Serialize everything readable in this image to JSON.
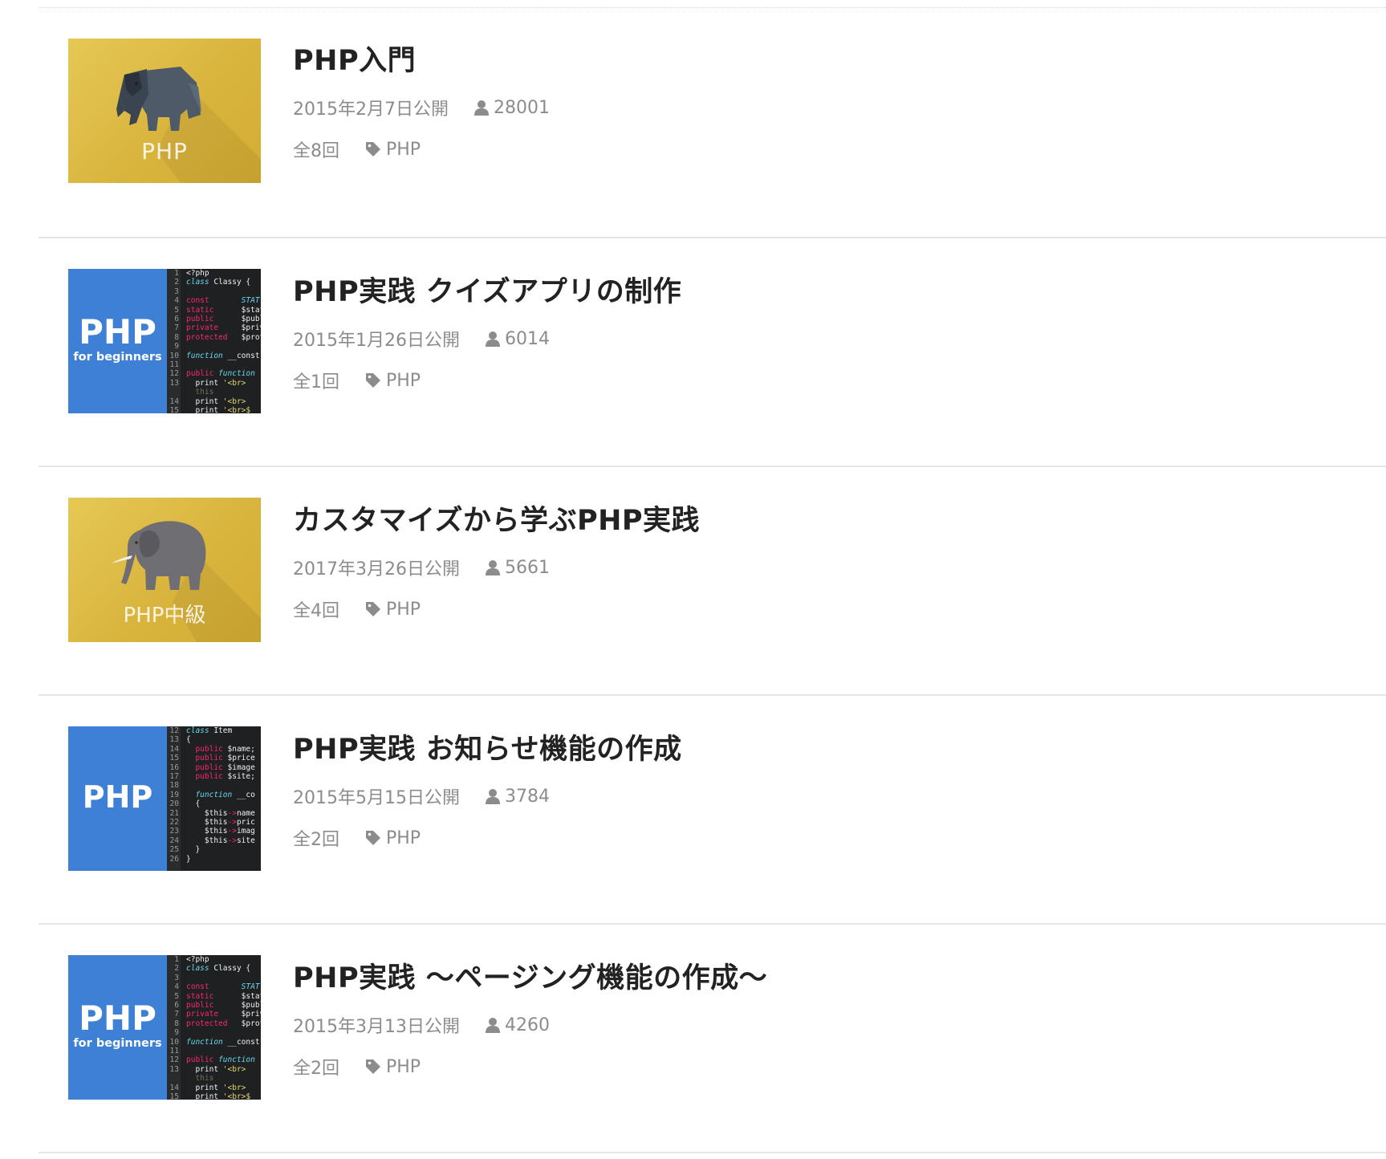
{
  "courses": [
    {
      "title": "PHP入門",
      "published": "2015年2月7日公開",
      "views": "28001",
      "episodes": "全8回",
      "tag": "PHP",
      "thumbnail": {
        "style": "gold",
        "icon": "elephant-icon",
        "label": "PHP"
      }
    },
    {
      "title": "PHP実践 クイズアプリの制作",
      "published": "2015年1月26日公開",
      "views": "6014",
      "episodes": "全1回",
      "tag": "PHP",
      "thumbnail": {
        "style": "blue-code",
        "big_label": "PHP",
        "sub_label": "for beginners"
      }
    },
    {
      "title": "カスタマイズから学ぶPHP実践",
      "published": "2017年3月26日公開",
      "views": "5661",
      "episodes": "全4回",
      "tag": "PHP",
      "thumbnail": {
        "style": "gold",
        "icon": "elephant-icon",
        "label": "PHP中級"
      }
    },
    {
      "title": "PHP実践 お知らせ機能の作成",
      "published": "2015年5月15日公開",
      "views": "3784",
      "episodes": "全2回",
      "tag": "PHP",
      "thumbnail": {
        "style": "blue-code",
        "big_label": "PHP",
        "sub_label": ""
      }
    },
    {
      "title": "PHP実践 〜ページング機能の作成〜",
      "published": "2015年3月13日公開",
      "views": "4260",
      "episodes": "全2回",
      "tag": "PHP",
      "thumbnail": {
        "style": "blue-code",
        "big_label": "PHP",
        "sub_label": "for beginners"
      }
    }
  ],
  "code_snippets": {
    "classy": {
      "lines": [
        "1",
        "2",
        "3",
        "4",
        "5",
        "6",
        "7",
        "8",
        "9",
        "10",
        "11",
        "12",
        "13",
        "",
        "14",
        "15"
      ],
      "code": [
        "<?php",
        "class Classy {",
        "",
        "const       STAT",
        "static      $stat",
        "public      $publ",
        "private     $priv",
        "protected   $prot",
        "",
        "function __const",
        "",
        "public function ",
        "  print '<br>'",
        "  this",
        "  print '<br>'",
        "  print '<br>$"
      ]
    },
    "item": {
      "lines": [
        "12",
        "13",
        "14",
        "15",
        "16",
        "17",
        "18",
        "19",
        "20",
        "21",
        "22",
        "23",
        "24",
        "25",
        "26"
      ],
      "code": [
        "class Item",
        "{",
        "  public $name;",
        "  public $price",
        "  public $image",
        "  public $site;",
        "",
        "  function __co",
        "  {",
        "    $this->name",
        "    $this->pric",
        "    $this->imag",
        "    $this->site",
        "  }",
        "}"
      ]
    }
  },
  "colors": {
    "title": "#222222",
    "meta": "#8c8c8c",
    "divider": "#e6e6e6",
    "gold": "#d9b53e",
    "blue": "#3d80d6",
    "code_bg": "#1f2021"
  }
}
